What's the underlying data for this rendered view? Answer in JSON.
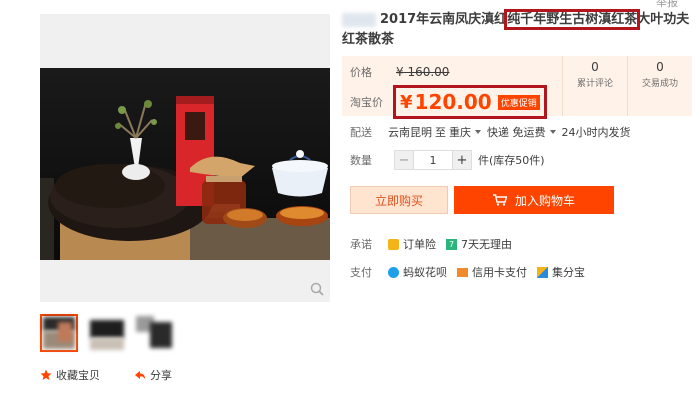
{
  "title": {
    "text_before": "2017年云南凤庆滇红",
    "text_highlight": "纯千年野生古树滇红茶",
    "text_after": "大叶功夫红茶散茶"
  },
  "top_link": "举报",
  "price_panel": {
    "price_label": "价格",
    "original_price": "¥ 160.00",
    "promo_label": "淘宝价",
    "currency": "¥",
    "price": "120.00",
    "promo_badge": "优惠促销",
    "reviews_count": "0",
    "reviews_label": "累计评论",
    "sales_count": "0",
    "sales_label": "交易成功"
  },
  "shipping": {
    "label": "配送",
    "from": "云南昆明",
    "to_word": "至",
    "dest": "重庆",
    "method": "快递 免运费",
    "time": "24小时内发货"
  },
  "quantity": {
    "label": "数量",
    "minus": "−",
    "value": "1",
    "plus": "+",
    "unit_stock": "件(库存50件)"
  },
  "buttons": {
    "buy_now": "立即购买",
    "add_to_cart": "加入购物车"
  },
  "promise": {
    "label": "承诺",
    "items": [
      "订单险",
      "7天无理由"
    ]
  },
  "payment": {
    "label": "支付",
    "methods": [
      "蚂蚁花呗",
      "信用卡支付",
      "集分宝"
    ]
  },
  "actions": {
    "favorite": "收藏宝贝",
    "share": "分享"
  },
  "colors": {
    "accent": "#ff4400",
    "highlight_box": "#b3151d",
    "price_bg": "#fff2e8"
  }
}
